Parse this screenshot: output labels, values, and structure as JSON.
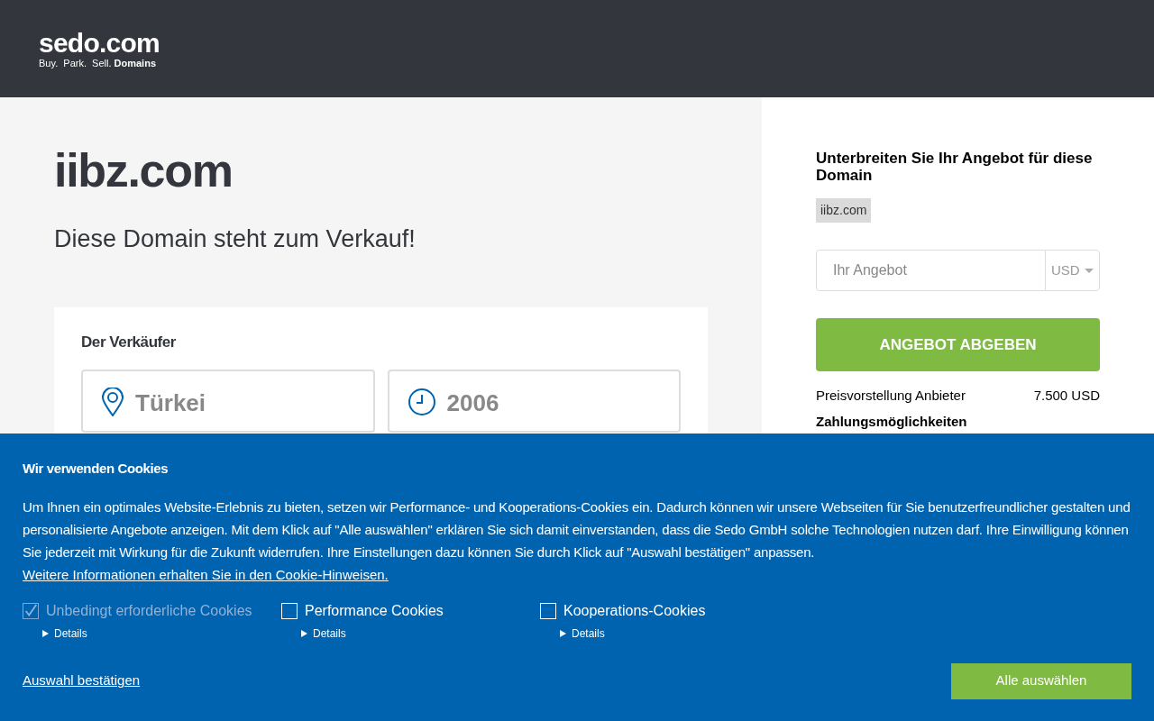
{
  "header": {
    "logo": {
      "name": "sedo.com",
      "tagline": "Buy.  Park.  Sell.",
      "tagline_bold": "Domains"
    }
  },
  "main": {
    "domain": "iibz.com",
    "subtitle": "Diese Domain steht zum Verkauf!",
    "seller": {
      "title": "Der Verkäufer",
      "facts": [
        {
          "kind": "location",
          "value": "Türkei"
        },
        {
          "kind": "since",
          "value": "2006"
        }
      ]
    }
  },
  "offer": {
    "title": "Unterbreiten Sie Ihr Angebot für diese Domain",
    "domain_tag": "iibz.com",
    "input": {
      "placeholder": "Ihr Angebot"
    },
    "currency": "USD",
    "submit": "ANGEBOT ABGEBEN",
    "price_label": "Preisvorstellung Anbieter",
    "price_value": "7.500 USD",
    "payment_title": "Zahlungsmöglichkeiten"
  },
  "cookie_banner": {
    "title": "Wir verwenden Cookies",
    "text": "Um Ihnen ein optimales Website-Erlebnis zu bieten, setzen wir Performance- und Kooperations-Cookies ein. Dadurch können wir unsere Webseiten für Sie benutzerfreundlicher gestalten und personalisierte Angebote anzeigen. Mit dem Klick auf \"Alle auswählen\" erklären Sie sich damit einverstanden, dass die Sedo GmbH solche Technologien nutzen darf. Ihre Einwilligung können Sie jederzeit mit Wirkung für die Zukunft widerrufen. Ihre Einstellungen dazu können Sie durch Klick auf \"Auswahl bestätigen\" anpassen.",
    "link": "Weitere Informationen erhalten Sie in den Cookie-Hinweisen.",
    "options": [
      {
        "label": "Unbedingt erforderliche Cookies",
        "checked": true,
        "disabled": true,
        "details": "Details"
      },
      {
        "label": "Performance Cookies",
        "checked": false,
        "disabled": false,
        "details": "Details"
      },
      {
        "label": "Kooperations-Cookies",
        "checked": false,
        "disabled": false,
        "details": "Details"
      }
    ],
    "confirm": "Auswahl bestätigen",
    "accept_all": "Alle auswählen"
  }
}
